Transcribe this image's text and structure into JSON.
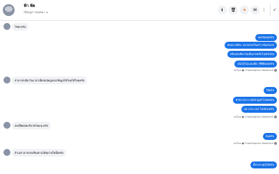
{
  "header": {
    "contact_name": "ฟ้า ฟ้ด",
    "status": "เรียกดูการสนทนา",
    "buttons": [
      "info-icon",
      "trash-icon",
      "star-icon",
      "mail-icon",
      "more-icon",
      "check-icon"
    ]
  },
  "thread": {
    "incoming": [
      {
        "text": "ไข่ค่ะครับ"
      },
      {
        "text": "สามารถเลือกวันเวลาเพื่อขอนัดมูลเอกข้อมูลได้ไหมได้ไหมครับ"
      },
      {
        "text": "ลดเช็คยอดบริจาคไหมน่ะครับ"
      },
      {
        "text": "ถ้าเอสามารถส่งเรื่องผ่านได้ทุกวันใช่มั้ยครับ"
      }
    ],
    "outgoing_group1": [
      "ยอดจัดสุดครับ",
      "นัดหมายทีละ หลายรอบในคร่าวพ้นกับเลก",
      "หรือเลยเลือกวันเพื่อมาทดรีบไปเสินไหม",
      "เงินโตไปแบบเดียว ที่ตีดิยอดครับ"
    ],
    "sender1": "ส่งโดย ● Chanitaphan Noserach",
    "outgoing_group2": [
      "ได้ครับ",
      "ชัวร์เราอาจารย์เข้าดูเข้าไปสังครับ",
      "แต่ 100-200 ไฟล์ตรงครับ"
    ],
    "sender2": "ส่งโดย ● Chanitaphan Noserach",
    "outgoing_group3": [
      "นั่นครับ"
    ],
    "sender3": "ส่งโดย ● Chanitaphan Noserach",
    "outgoing_group4": [
      "ตั้งระยะคุณได้ครับ"
    ]
  }
}
